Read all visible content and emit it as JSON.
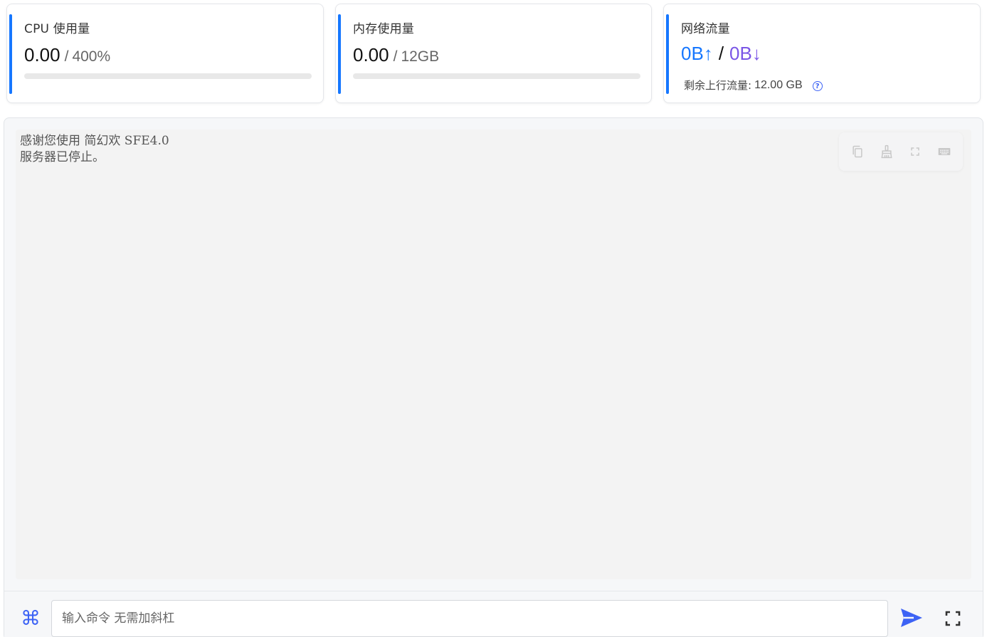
{
  "cpu": {
    "title": "CPU 使用量",
    "value": "0.00",
    "separator": "/",
    "total": "400%",
    "progress": 0
  },
  "memory": {
    "title": "内存使用量",
    "value": "0.00",
    "separator": "/",
    "total": "12GB",
    "progress": 0
  },
  "network": {
    "title": "网络流量",
    "up": "0B↑",
    "separator": "/",
    "down": "0B↓",
    "remaining_label": "剩余上行流量:",
    "remaining_value": "12.00 GB",
    "help_icon": "question-circle-icon"
  },
  "terminal": {
    "lines": [
      "感谢您使用 简幻欢 SFE4.0",
      "服务器已停止。"
    ],
    "toolbar": [
      "copy-icon",
      "clear-broom-icon",
      "expand-icon",
      "keyboard-icon"
    ]
  },
  "command": {
    "icon": "command-icon",
    "icon_glyph": "⌘",
    "placeholder": "输入命令 无需加斜杠",
    "value": "",
    "send_icon": "send-icon",
    "fullscreen_icon": "fullscreen-icon"
  },
  "colors": {
    "accent": "#1677ff",
    "upload": "#1677ff",
    "download": "#7a56e6",
    "icon_blue": "#3d63f5"
  }
}
